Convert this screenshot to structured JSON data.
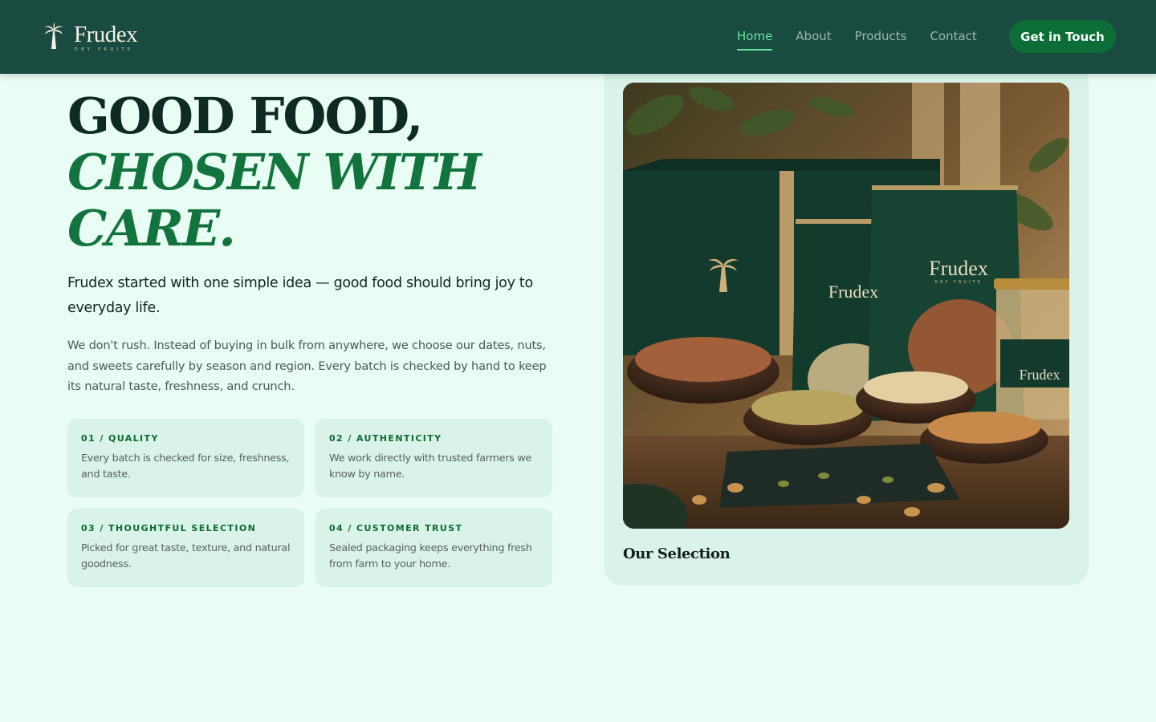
{
  "nav": {
    "brand_name": "Frudex",
    "brand_sub": "DRY FRUITS",
    "links": [
      {
        "label": "Home",
        "active": true
      },
      {
        "label": "About",
        "active": false
      },
      {
        "label": "Products",
        "active": false
      },
      {
        "label": "Contact",
        "active": false
      }
    ],
    "cta_label": "Get in Touch"
  },
  "hero": {
    "title_line1": "GOOD FOOD,",
    "title_line2": "CHOSEN WITH CARE.",
    "lead": "Frudex started with one simple idea — good food should bring joy to everyday life.",
    "body": "We don't rush. Instead of buying in bulk from anywhere, we choose our dates, nuts, and sweets carefully by season and region. Every batch is checked by hand to keep its natural taste, freshness, and crunch."
  },
  "features": [
    {
      "heading": "01 / QUALITY",
      "text": "Every batch is checked for size, freshness, and taste."
    },
    {
      "heading": "02 / AUTHENTICITY",
      "text": "We work directly with trusted farmers we know by name."
    },
    {
      "heading": "03 / THOUGHTFUL SELECTION",
      "text": "Picked for great taste, texture, and natural goodness."
    },
    {
      "heading": "04 / CUSTOMER TRUST",
      "text": "Sealed packaging keeps everything fresh from farm to your home."
    }
  ],
  "selection": {
    "caption": "Our Selection",
    "image_label": "Frudex",
    "image_sublabel": "DRY FRUITS"
  },
  "colors": {
    "nav_bg": "#1a4b41",
    "page_bg": "#e8fdf4",
    "accent_green": "#0d6d36",
    "active_link": "#68e39c"
  }
}
